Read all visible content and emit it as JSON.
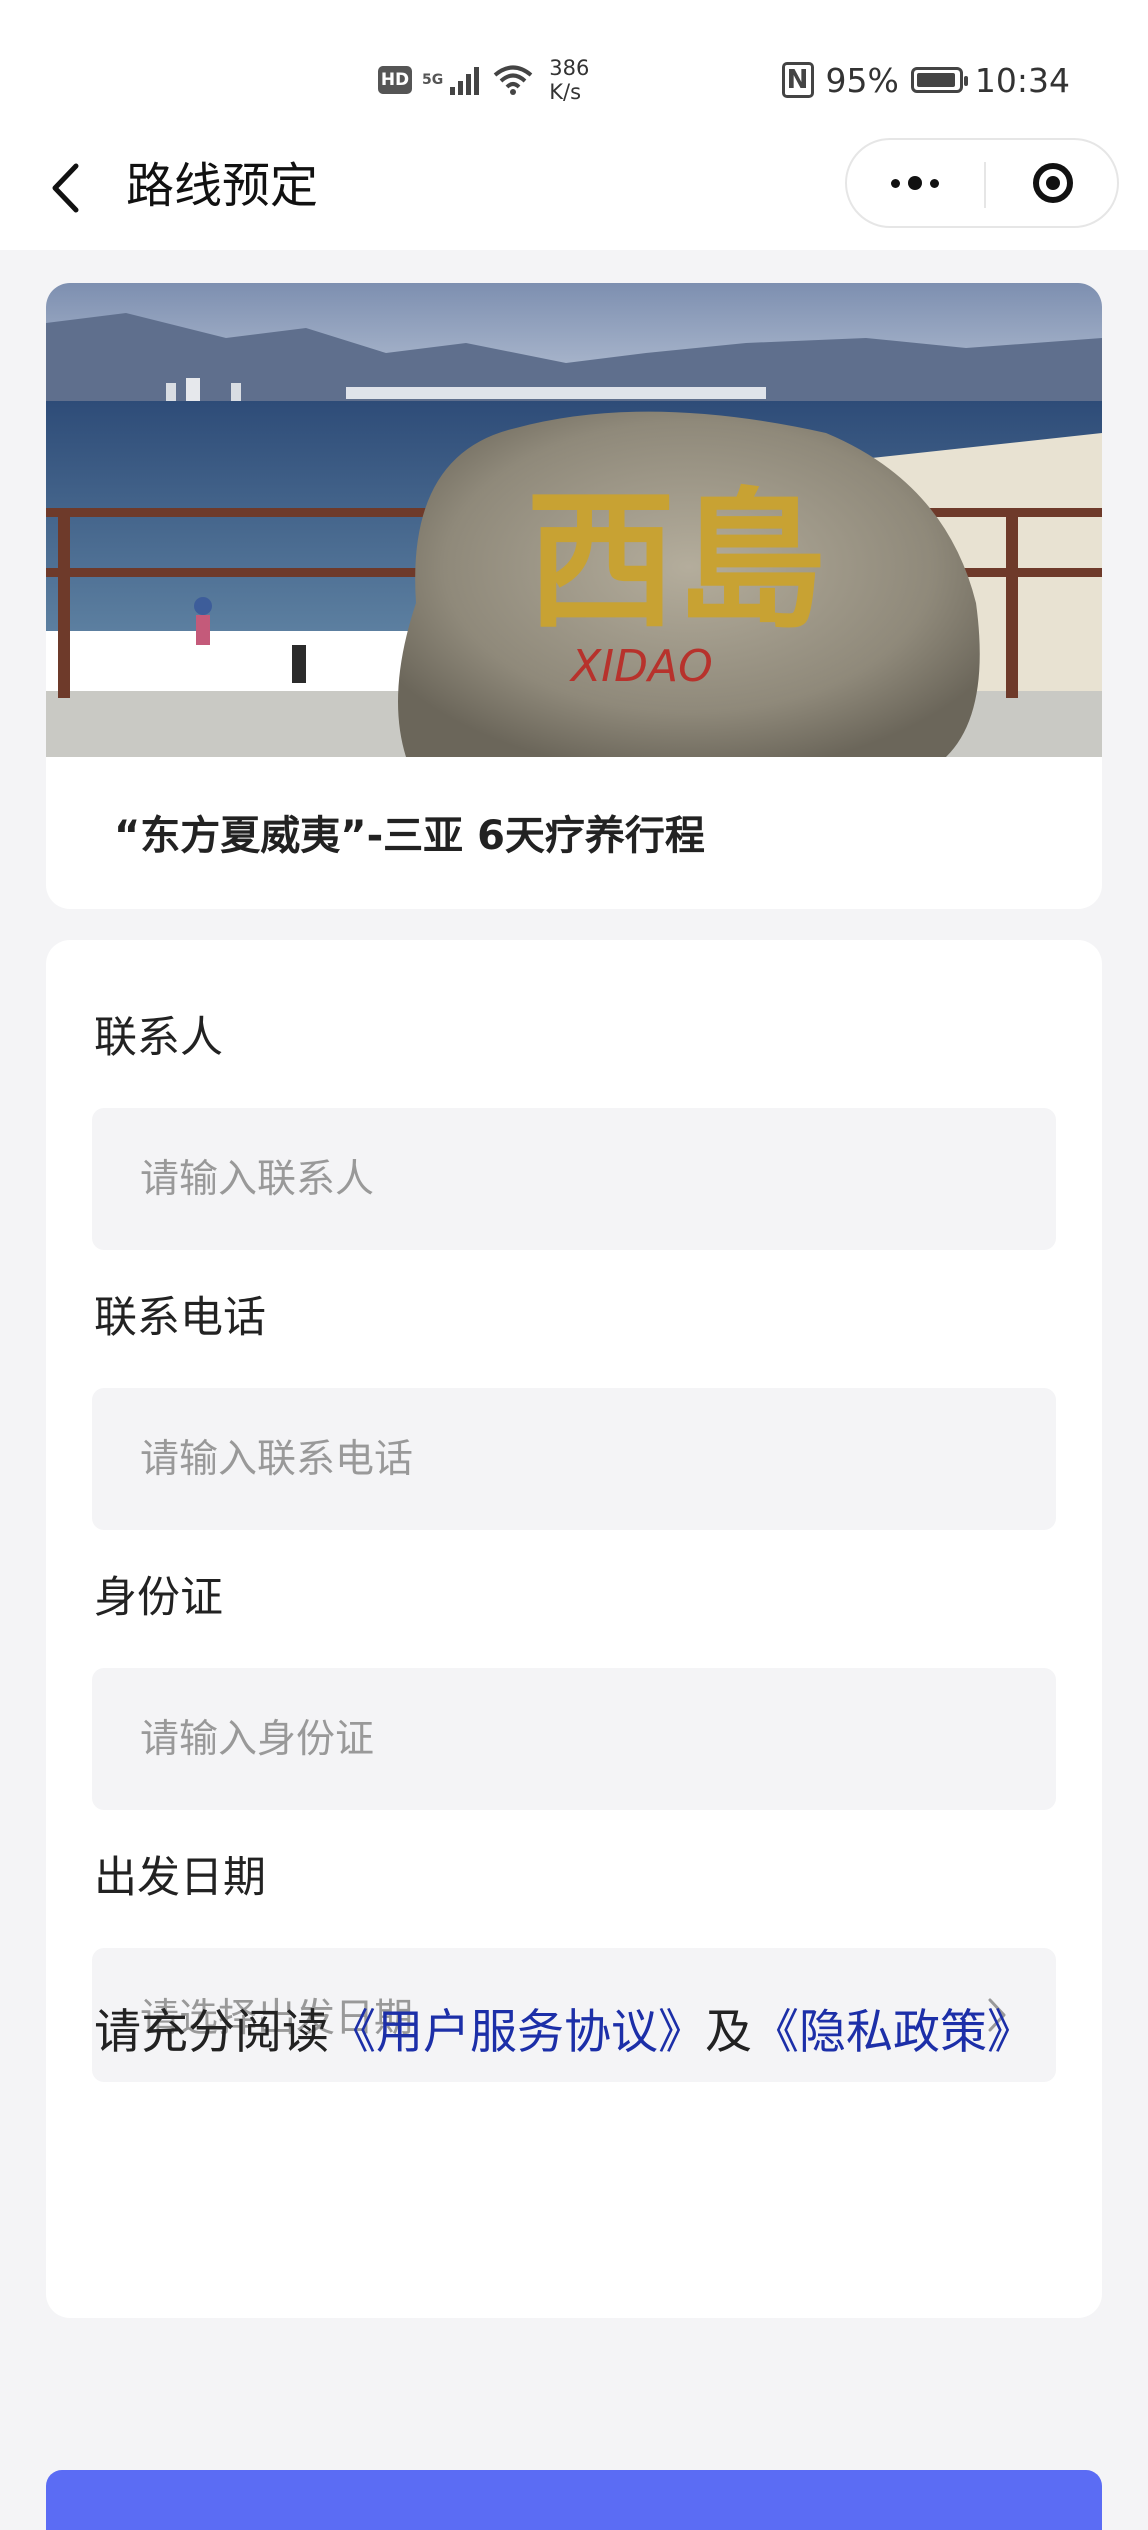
{
  "status_bar": {
    "hd": "HD",
    "network": "5G",
    "speed_value": "386",
    "speed_unit": "K/s",
    "nfc": "N",
    "battery": "95%",
    "battery_level": 0.95,
    "time": "10:34"
  },
  "nav": {
    "title": "路线预定",
    "icons": {
      "back": "chevron-left-icon",
      "more": "more-dots-icon",
      "close": "target-circle-icon"
    }
  },
  "route": {
    "image_alt": "西岛 XIDAO",
    "title": "“东方夏威夷”-三亚 6天疗养行程"
  },
  "form": {
    "contact": {
      "label": "联系人",
      "placeholder": "请输入联系人"
    },
    "phone": {
      "label": "联系电话",
      "placeholder": "请输入联系电话"
    },
    "id_card": {
      "label": "身份证",
      "placeholder": "请输入身份证"
    },
    "departure": {
      "label": "出发日期",
      "placeholder": "请选择出发日期",
      "icon": "chevron-right-icon"
    }
  },
  "agreement": {
    "prefix": "请充分阅读",
    "service_link": "《用户服务协议》",
    "conjunction": "及",
    "privacy_link": "《隐私政策》"
  },
  "colors": {
    "link": "#1c2fa8",
    "submit": "#5b6cf4",
    "page_bg": "#f4f4f6"
  }
}
